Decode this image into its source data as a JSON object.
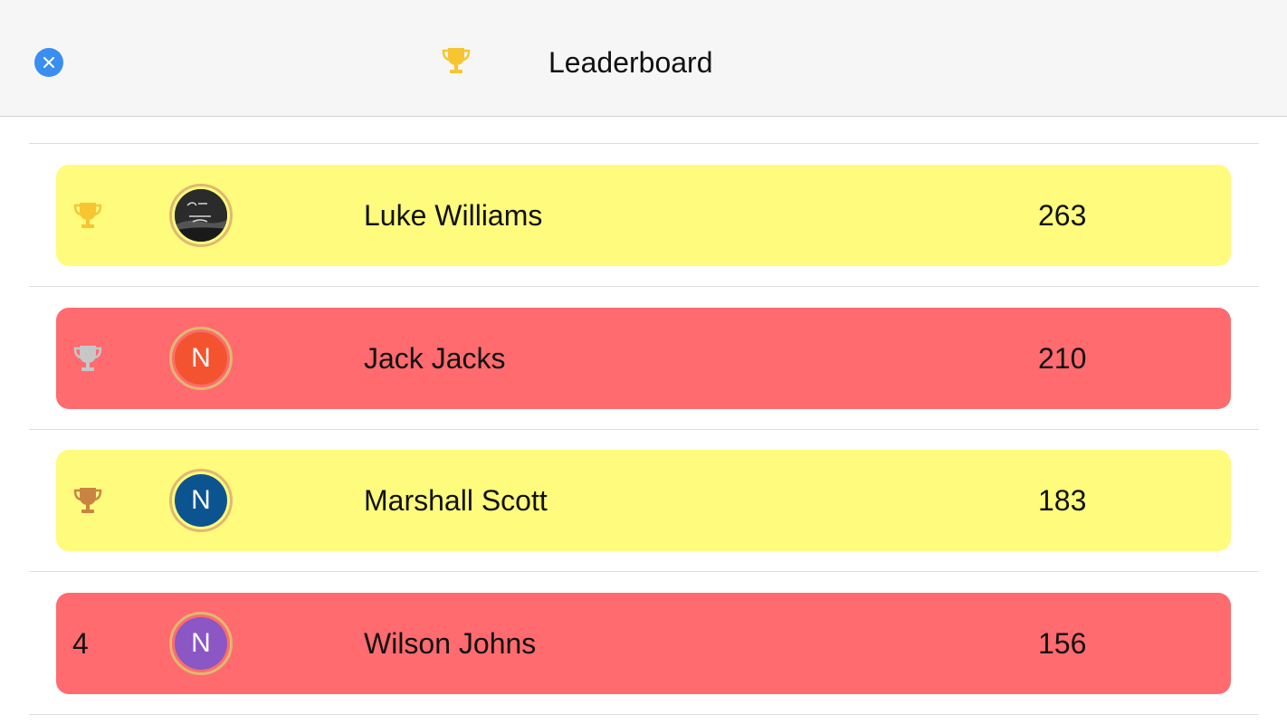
{
  "header": {
    "title": "Leaderboard",
    "close_icon": "close-icon",
    "trophy_icon": "trophy-icon",
    "trophy_color": "#f7c531",
    "close_color": "#3a8ef0"
  },
  "leaderboard": {
    "entries": [
      {
        "rank_display": "trophy-gold",
        "trophy_color": "#f7c531",
        "avatar_type": "photo",
        "avatar_letter": "",
        "name": "Luke Williams",
        "score": "263",
        "row_color": "#fffb7d"
      },
      {
        "rank_display": "trophy-silver",
        "trophy_color": "#c7c7c7",
        "avatar_type": "letter",
        "avatar_letter": "N",
        "avatar_color": "#f4532f",
        "name": "Jack Jacks",
        "score": "210",
        "row_color": "#ff6b6e"
      },
      {
        "rank_display": "trophy-bronze",
        "trophy_color": "#c98443",
        "avatar_type": "letter",
        "avatar_letter": "N",
        "avatar_color": "#0b5490",
        "name": "Marshall Scott",
        "score": "183",
        "row_color": "#fffb7d"
      },
      {
        "rank_display": "number",
        "rank_number": "4",
        "avatar_type": "letter",
        "avatar_letter": "N",
        "avatar_color": "#8a57c4",
        "name": "Wilson Johns",
        "score": "156",
        "row_color": "#ff6b6e"
      }
    ]
  }
}
